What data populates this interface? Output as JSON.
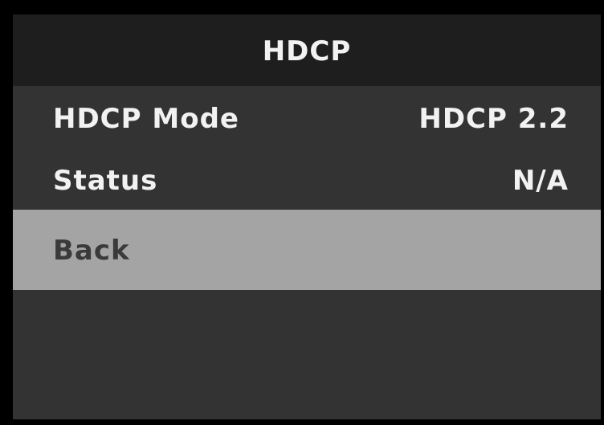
{
  "menu": {
    "title": "HDCP",
    "items": [
      {
        "label": "HDCP Mode",
        "value": "HDCP 2.2"
      },
      {
        "label": "Status",
        "value": "N/A"
      },
      {
        "label": "Back",
        "selected": true
      }
    ]
  },
  "colors": {
    "title_bar": "#1e1e1e",
    "panel": "#333333",
    "selected_row": "#a4a4a4",
    "text": "#f2f2f2",
    "selected_text": "#3a3a3a"
  }
}
